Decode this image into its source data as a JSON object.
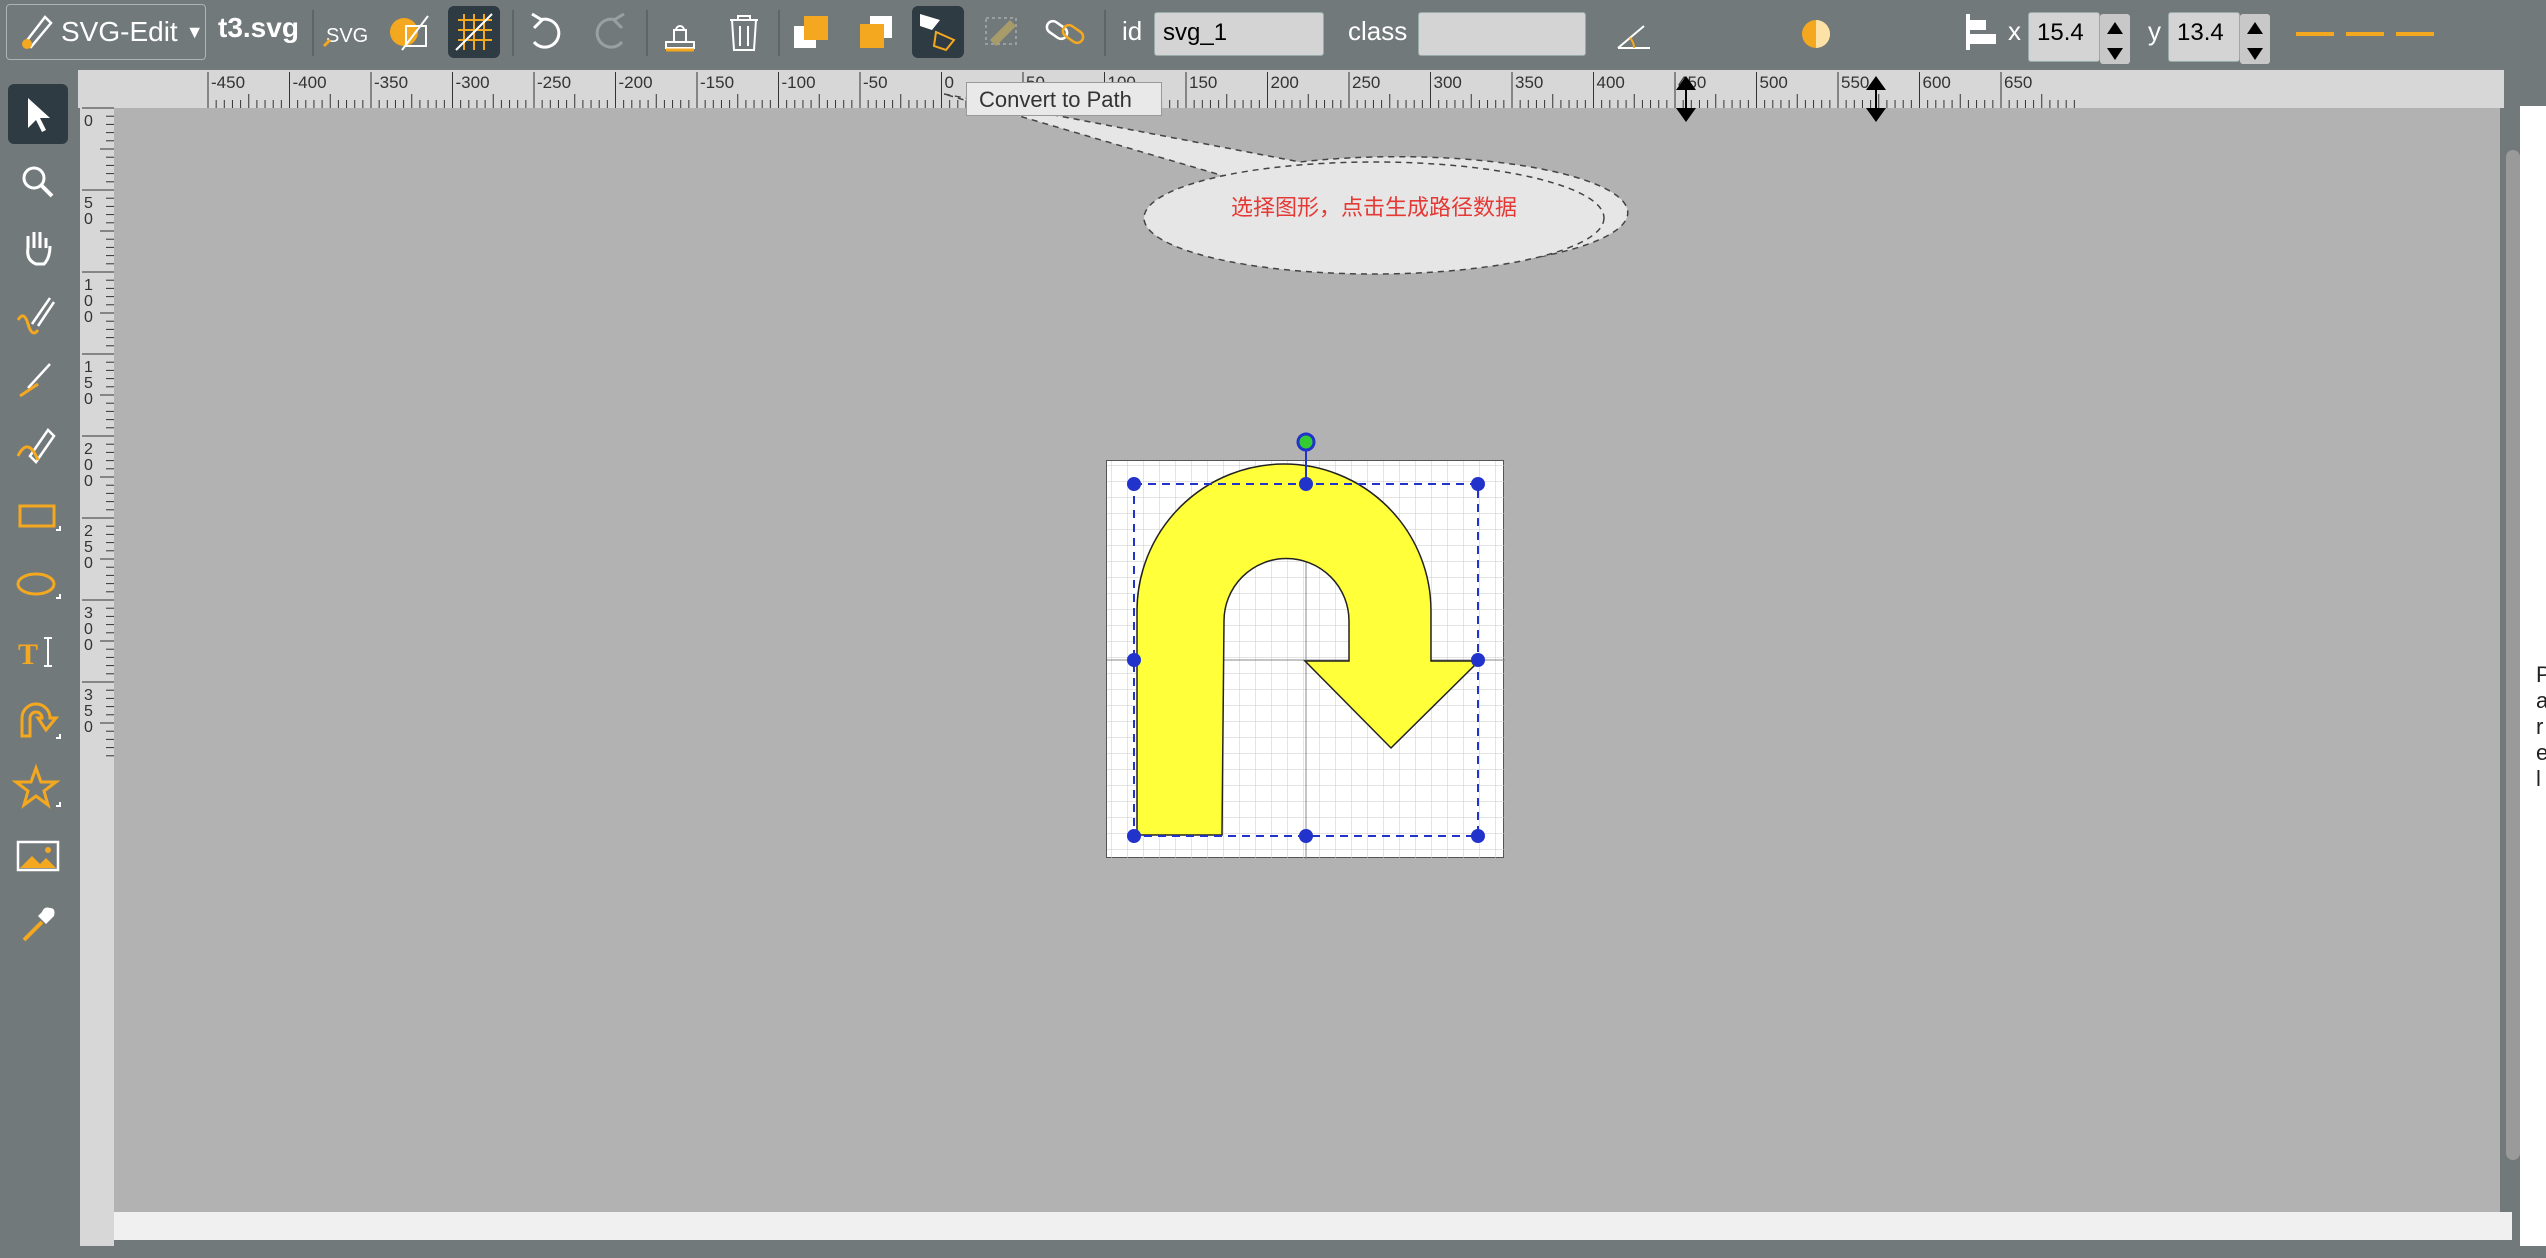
{
  "app": {
    "name": "SVG-Edit",
    "filename": "t3.svg"
  },
  "toolbar": {
    "id_label": "id",
    "id_value": "svg_1",
    "class_label": "class",
    "class_value": "",
    "x_label": "x",
    "x_value": "15.4",
    "y_label": "y",
    "y_value": "13.4",
    "tooltip": "Convert to Path",
    "icons": [
      "svg-icon",
      "export-icon",
      "grid-icon",
      "undo-icon",
      "redo-icon",
      "clone-icon",
      "delete-icon",
      "move-to-front-icon",
      "move-to-back-icon",
      "convert-to-path-icon",
      "reorient-icon",
      "link-icon",
      "angle-icon",
      "opacity-icon",
      "align-icon"
    ]
  },
  "left_tools": [
    "select-tool",
    "zoom-tool",
    "pan-tool",
    "freehand-tool",
    "line-tool",
    "path-tool",
    "rect-tool",
    "ellipse-tool",
    "text-tool",
    "shapelib-tool",
    "star-tool",
    "image-tool",
    "eyedropper-tool"
  ],
  "ruler": {
    "top_labels": [
      "-450",
      "-400",
      "-350",
      "-300",
      "-250",
      "-200",
      "-150",
      "-100",
      "-50",
      "0",
      "50",
      "100",
      "150",
      "200",
      "250",
      "300",
      "350",
      "400",
      "450",
      "500",
      "550",
      "600",
      "650"
    ],
    "left_labels": [
      "0",
      "50",
      "100",
      "150",
      "200",
      "250",
      "300",
      "350"
    ]
  },
  "callout": {
    "text": "选择图形，点击生成路径数据"
  },
  "side_text": [
    "P",
    "a",
    "r",
    "e",
    "l"
  ],
  "colors": {
    "accent": "#f4a81f",
    "arrow_fill": "#ffff3a",
    "selection": "#2233cc",
    "callout_text": "#e53935"
  }
}
